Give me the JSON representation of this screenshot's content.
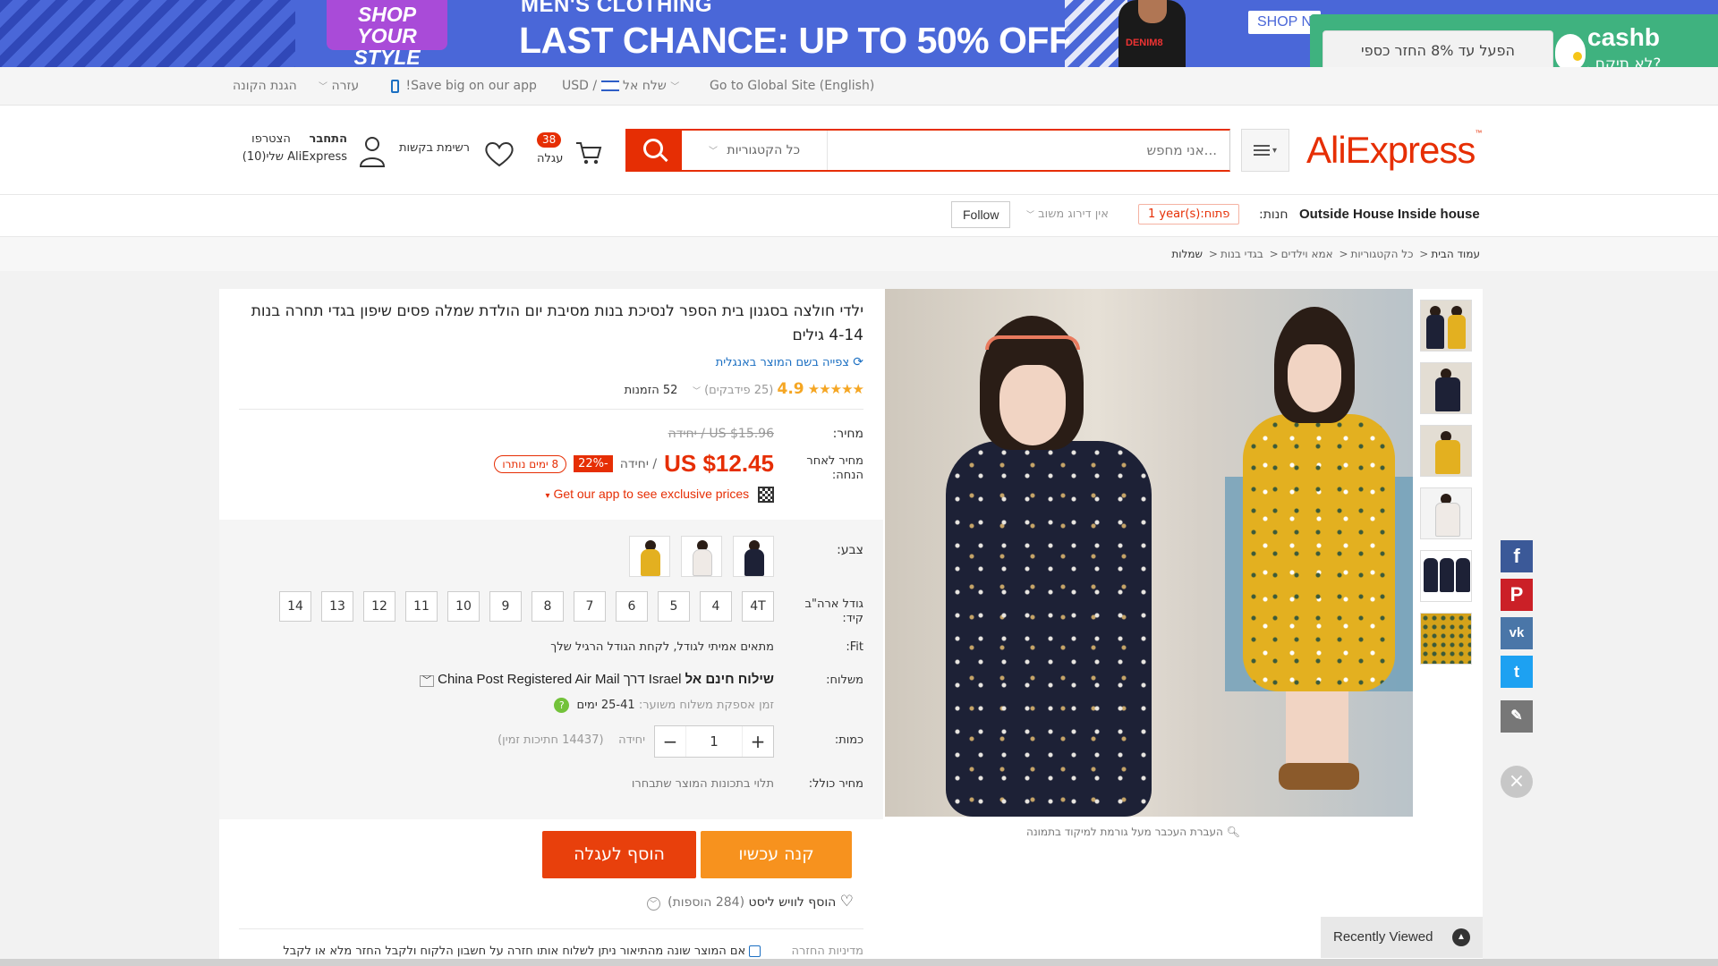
{
  "banner": {
    "shop_style": "SHOP YOUR STYLE",
    "mens": "MEN'S CLOTHING",
    "headline": "LAST CHANCE: UP TO 50% OFF",
    "shop_now": "SHOP N",
    "tee_text": "DENIM8"
  },
  "cashback": {
    "button": "הפעל עד 8% החזר כספי",
    "brand": "cashb",
    "sub": "?לא תיקח ,"
  },
  "topbar": {
    "global_site": "Go to Global Site (English)",
    "ship_to": "שלח אל",
    "currency": "USD",
    "app_promo": "!Save big on our app",
    "help": "עזרה",
    "buyer_protection": "הגנת הקונה"
  },
  "header": {
    "logo": "AliExpress",
    "search_placeholder": "...אני מחפש",
    "category": "כל הקטגוריות",
    "cart_count": "38",
    "cart_label": "עגלה",
    "wishlist_label": "רשימת בקשות",
    "login": "התחבר",
    "join": "הצטרפו",
    "my_aliexpress": "AliExpress שלי(10)"
  },
  "store": {
    "label": "חנות:",
    "name": "Outside House Inside house",
    "years": "1 year(s):פתוח",
    "rating": "אין דירוג משוב",
    "follow": "Follow"
  },
  "breadcrumb": [
    "עמוד הבית",
    "כל הקטגוריות",
    "אמא וילדים",
    "בגדי בנות",
    "שמלות"
  ],
  "product": {
    "title": "ילדי חולצה בסגנון בית הספר לנסיכת בנות מסיבת יום הולדת שמלה פסים שיפון בגדי תחרה בנות 4-14 גילים",
    "translate": "צפייה בשם המוצר באנגלית",
    "rating": "4.9",
    "feedback": "(25 פידבקים)",
    "orders": "52 הזמנות",
    "price_label": "מחיר:",
    "old_price": "US $15.96 / יחידה",
    "discount_label": "מחיר לאחר הנחה:",
    "price": "US $12.45",
    "unit": "/ יחידה",
    "discount": "-22%",
    "days_left": "8 ימים נותרו",
    "app_link": "Get our app to see exclusive prices",
    "color_label": "צבע:",
    "size_label": "גודל ארה\"ב קיד:",
    "sizes": [
      "4T",
      "4",
      "5",
      "6",
      "7",
      "8",
      "9",
      "10",
      "11",
      "12",
      "13",
      "14"
    ],
    "fit_label": "Fit:",
    "fit_value": "מתאים אמיתי לגודל, לקחת הגודל הרגיל שלך",
    "shipping_label": "משלוח:",
    "shipping_free": "שילוח חינם אל",
    "shipping_value": "Israel דרך China Post Registered Air Mail",
    "delivery_prefix": "זמן אספקת משלוח משוער:",
    "delivery_days": "25-41 ימים",
    "qty_label": "כמות:",
    "qty_value": "1",
    "qty_unit": "יחידה",
    "available": "(14437 חתיכות זמין)",
    "total_label": "מחיר כולל:",
    "total_value": "תלוי בתכונות המוצר שתבחרו",
    "buy_now": "קנה עכשיו",
    "add_to_cart": "הוסף לעגלה",
    "add_wishlist": "הוסף לוויש ליסט",
    "wishlist_count": "(284 הוספות)",
    "returns_label": "מדיניות החזרה",
    "returns_text": "אם המוצר שונה מהתיאור ניתן לשלוח אותו חזרה על חשבון הלקוח ולקבל החזר מלא או לקבל",
    "zoom_hint": "העברת העכבר מעל גורמת למיקוד בתמונה"
  },
  "social": {
    "fb": "f",
    "pin": "P",
    "vk": "vk",
    "tw": "t",
    "edit": "✎",
    "close": "×"
  },
  "recently_viewed": "Recently Viewed"
}
